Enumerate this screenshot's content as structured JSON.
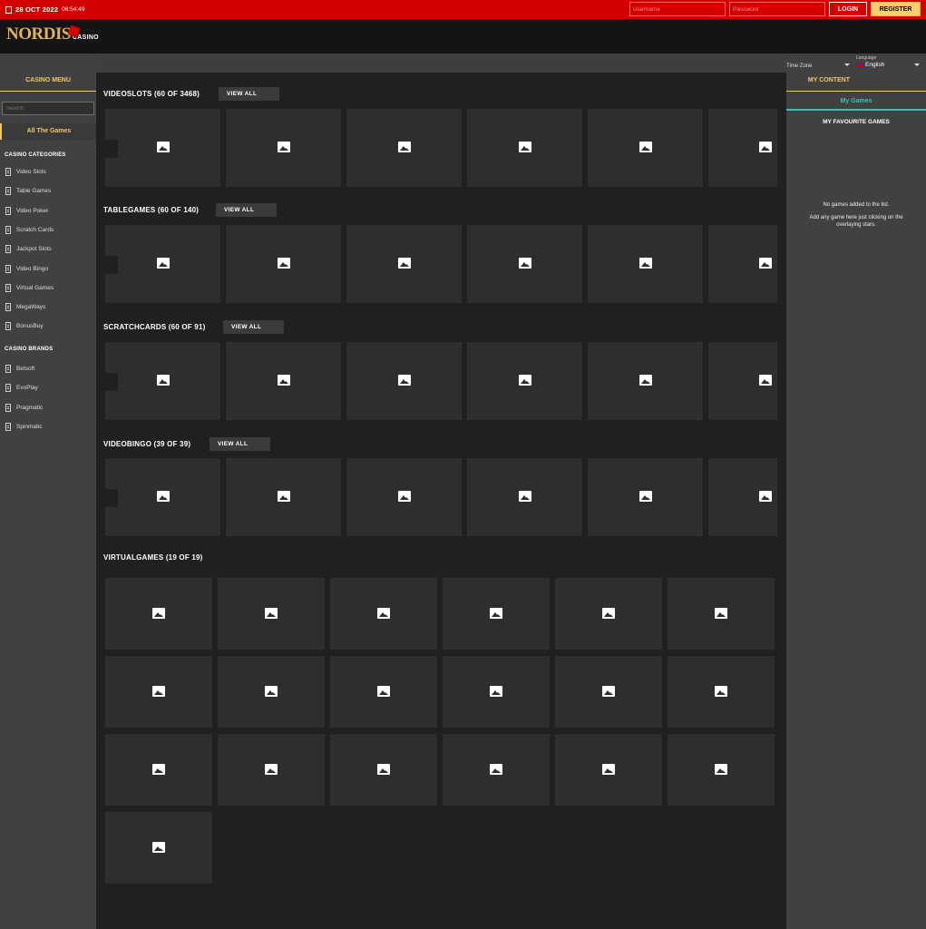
{
  "topbar": {
    "date": "28 OCT 2022",
    "time": "06:54:49",
    "username_placeholder": "Username",
    "password_placeholder": "Password",
    "login_label": "LOGIN",
    "register_label": "REGISTER"
  },
  "logo": {
    "brand": "NORDIS",
    "sub": "CASINO"
  },
  "left": {
    "title": "CASINO MENU",
    "search_placeholder": "Search",
    "all_games": "All The Games",
    "categories_title": "CASINO CATEGORIES",
    "categories": [
      "Video Slots",
      "Table Games",
      "Video Poker",
      "Scratch Cards",
      "Jackpot Slots",
      "Video Bingo",
      "Virtual Games",
      "MegaWays",
      "BonusBuy"
    ],
    "brands_title": "CASINO BRANDS",
    "brands": [
      "Betsoft",
      "EvoPlay",
      "Pragmatic",
      "Spinmatic"
    ]
  },
  "main": {
    "view_all": "VIEW ALL",
    "sections": [
      {
        "title": "VIDEOSLOTS  (60 OF 3468)"
      },
      {
        "title": "TABLEGAMES  (60 OF 140)"
      },
      {
        "title": "SCRATCHCARDS  (60 OF 91)"
      },
      {
        "title": "VIDEOBINGO  (39 OF 39)"
      },
      {
        "title": "VIRTUALGAMES  (19 OF 19)"
      }
    ]
  },
  "right": {
    "timezone_label": "Time Zone",
    "language_label": "Language",
    "language_value": "English",
    "title": "MY CONTENT",
    "tab": "My Games",
    "fav_title": "MY FAVOURITE GAMES",
    "empty_line1": "No games added to the list.",
    "empty_line2": "Add any game here just clicking on the overlaying stars."
  }
}
